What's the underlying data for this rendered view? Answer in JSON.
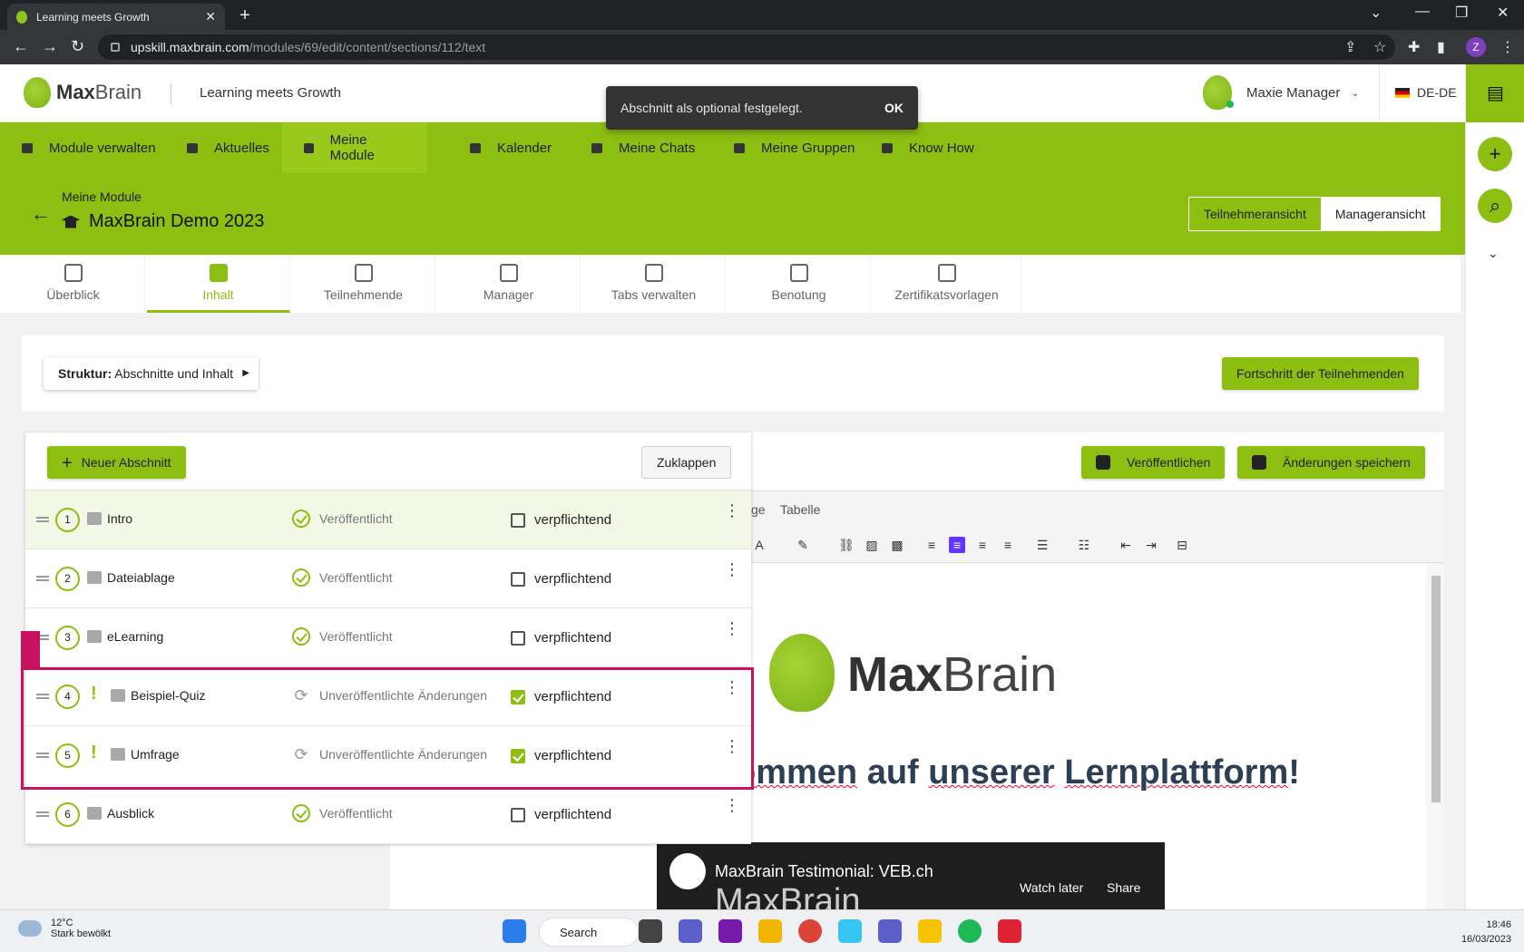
{
  "browser": {
    "tab_title": "Learning meets Growth",
    "url_host": "upskill.maxbrain.com",
    "url_path": "/modules/69/edit/content/sections/112/text",
    "profile_initial": "Z"
  },
  "header": {
    "logo_max": "Max",
    "logo_brain": "Brain",
    "tagline": "Learning meets Growth",
    "user_name": "Maxie Manager",
    "language": "DE-DE"
  },
  "snackbar": {
    "message": "Abschnitt als optional festgelegt.",
    "action": "OK"
  },
  "main_nav": [
    {
      "label": "Module verwalten"
    },
    {
      "label": "Aktuelles"
    },
    {
      "label": "Meine Module"
    },
    {
      "label": "Kalender"
    },
    {
      "label": "Meine Chats"
    },
    {
      "label": "Meine Gruppen"
    },
    {
      "label": "Know How"
    }
  ],
  "page": {
    "breadcrumb": "Meine Module",
    "title": "MaxBrain Demo 2023",
    "view_participant": "Teilnehmeransicht",
    "view_manager": "Manageransicht"
  },
  "tabs": [
    {
      "label": "Überblick"
    },
    {
      "label": "Inhalt"
    },
    {
      "label": "Teilnehmende"
    },
    {
      "label": "Manager"
    },
    {
      "label": "Tabs verwalten"
    },
    {
      "label": "Benotung"
    },
    {
      "label": "Zertifikatsvorlagen"
    }
  ],
  "structure": {
    "label_bold": "Struktur:",
    "label_rest": " Abschnitte und Inhalt",
    "progress_button": "Fortschritt der Teilnehmenden"
  },
  "sections_panel": {
    "new_section": "Neuer Abschnitt",
    "collapse": "Zuklappen",
    "rows": [
      {
        "num": "1",
        "label": "Intro",
        "status": "Veröffentlicht",
        "mandatory_label": "verpflichtend",
        "mandatory": false,
        "warning": ""
      },
      {
        "num": "2",
        "label": "Dateiablage",
        "status": "Veröffentlicht",
        "mandatory_label": "verpflichtend",
        "mandatory": false,
        "warning": ""
      },
      {
        "num": "3",
        "label": "eLearning",
        "status": "Veröffentlicht",
        "mandatory_label": "verpflichtend",
        "mandatory": false,
        "warning": ""
      },
      {
        "num": "4",
        "label": "Beispiel-Quiz",
        "status": "Unveröffentlichte Änderungen",
        "mandatory_label": "verpflichtend",
        "mandatory": true,
        "warning": "!"
      },
      {
        "num": "5",
        "label": "Umfrage",
        "status": "Unveröffentlichte Änderungen",
        "mandatory_label": "verpflichtend",
        "mandatory": true,
        "warning": "!"
      },
      {
        "num": "6",
        "label": "Ausblick",
        "status": "Veröffentlicht",
        "mandatory_label": "verpflichtend",
        "mandatory": false,
        "warning": ""
      }
    ]
  },
  "editor": {
    "publish": "Veröffentlichen",
    "save": "Änderungen speichern",
    "menu_partial": "ge",
    "menu_table": "Tabelle",
    "doc_logo_max": "Max",
    "doc_logo_brain": "Brain",
    "heading_part1": "ommen",
    "heading_part2": " auf ",
    "heading_part3": "unserer",
    "heading_part4": " ",
    "heading_part5": "Lernplattform",
    "heading_part6": "!",
    "video_title": "MaxBrain Testimonial: VEB.ch",
    "video_watch_later": "Watch later",
    "video_share": "Share",
    "video_logo_text": "MaxBrain"
  },
  "taskbar": {
    "temp": "12°C",
    "weather": "Stark bewölkt",
    "search": "Search",
    "time": "18:46",
    "date": "16/03/2023"
  }
}
